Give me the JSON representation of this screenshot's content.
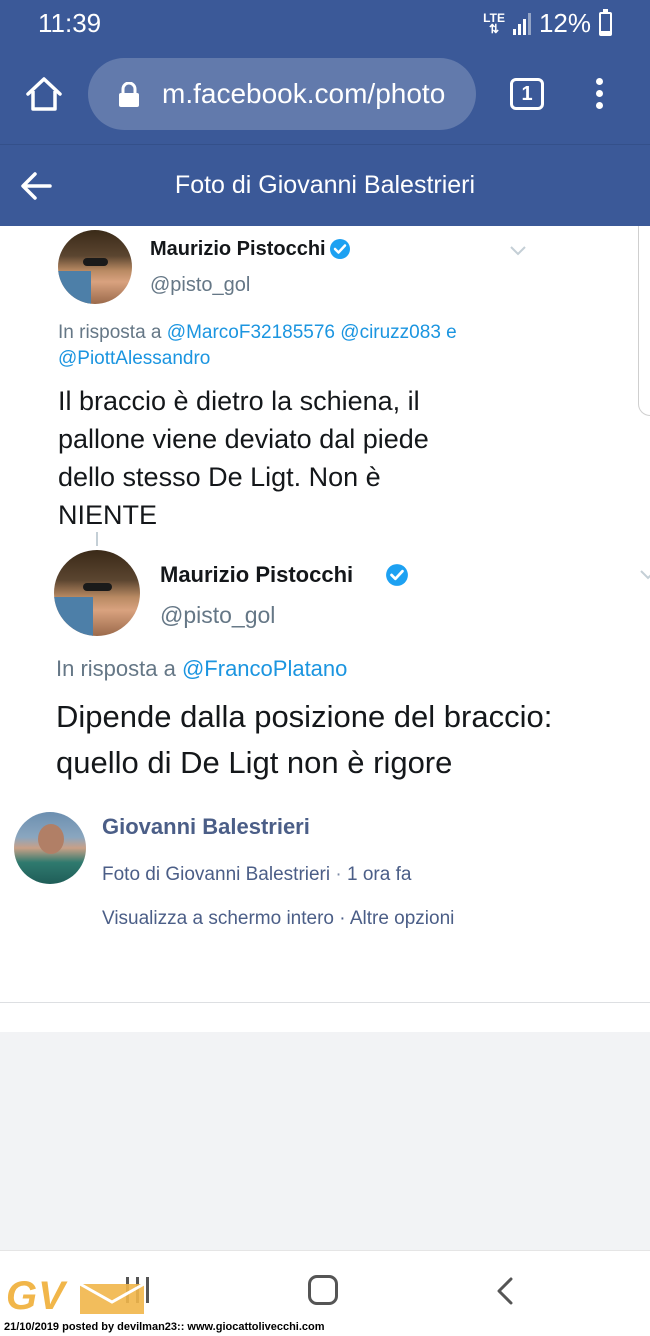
{
  "status_bar": {
    "time": "11:39",
    "network": "LTE",
    "battery": "12%",
    "battery_level": 0.12
  },
  "browser": {
    "url": "m.facebook.com/photo",
    "tab_count": "1"
  },
  "header": {
    "title": "Foto di Giovanni Balestrieri"
  },
  "photo": {
    "tweets": [
      {
        "name": "Maurizio Pistocchi",
        "handle": "@pisto_gol",
        "reply_prefix": "In risposta a",
        "reply_to_line1": "@MarcoF32185576 @ciruzz083 e",
        "reply_to_line2": "@PiottAlessandro",
        "text_lines": [
          "Il braccio è dietro la schiena, il",
          "pallone viene deviato dal piede",
          "dello stesso De Ligt. Non è",
          "NIENTE"
        ]
      },
      {
        "name": "Maurizio Pistocchi",
        "handle": "@pisto_gol",
        "reply_prefix": "In risposta a",
        "reply_to_line1": "@FrancoPlatano",
        "text_lines": [
          "Dipende dalla posizione del braccio:",
          "quello di De Ligt non è rigore"
        ]
      }
    ]
  },
  "post": {
    "author": "Giovanni Balestrieri",
    "meta_label": "Foto di Giovanni Balestrieri",
    "meta_separator": "·",
    "time_ago": "1 ora fa",
    "action_fullscreen": "Visualizza a schermo intero",
    "action_separator": "·",
    "action_more": "Altre opzioni"
  },
  "watermark": {
    "logo_text": "GV",
    "caption": "21/10/2019 posted by devilman23:: www.giocattolivecchi.com"
  },
  "colors": {
    "facebook_blue": "#3b5998",
    "twitter_link": "#1b95e0",
    "text_secondary": "#657786",
    "link_text": "#4b5e87"
  }
}
